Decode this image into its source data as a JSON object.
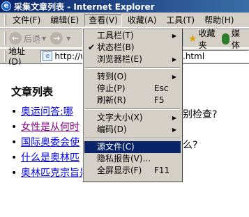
{
  "window": {
    "title": "采集文章列表 - Internet Explorer"
  },
  "menubar": {
    "items": [
      {
        "label": "文件(F)"
      },
      {
        "label": "编辑(E)"
      },
      {
        "label": "查看(V)"
      },
      {
        "label": "收藏(A)"
      },
      {
        "label": "工具(T)"
      },
      {
        "label": "帮助(H)"
      }
    ]
  },
  "toolbar": {
    "back_label": "后退",
    "favorites_label": "收藏夹",
    "media_label": "媒体"
  },
  "address": {
    "label": "地址(D)",
    "url_left": "http://w",
    "url_right": "c.html"
  },
  "page": {
    "heading": "文章列表",
    "bullet": "•",
    "articles": [
      {
        "left": "奥运问答:哪",
        "right": "别检查?"
      },
      {
        "left": "女性是从何时",
        "right": ""
      },
      {
        "left": "国际奥委会使",
        "right": "么?"
      },
      {
        "left": "什么是奥林匹",
        "right": ""
      },
      {
        "left": "奥林匹克宗旨是什么?",
        "right": ""
      }
    ]
  },
  "view_menu": {
    "items": [
      {
        "label": "工具栏(T)",
        "shortcut": "",
        "submenu": true
      },
      {
        "label": "状态栏(B)",
        "shortcut": "",
        "checked": true
      },
      {
        "label": "浏览器栏(E)",
        "shortcut": "",
        "submenu": true
      },
      {
        "label": "转到(O)",
        "shortcut": "",
        "submenu": true
      },
      {
        "label": "停止(P)",
        "shortcut": "Esc"
      },
      {
        "label": "刷新(R)",
        "shortcut": "F5"
      },
      {
        "label": "文字大小(X)",
        "shortcut": "",
        "submenu": true
      },
      {
        "label": "编码(D)",
        "shortcut": "",
        "submenu": true
      },
      {
        "label": "源文件(C)",
        "shortcut": ""
      },
      {
        "label": "隐私报告(V)...",
        "shortcut": ""
      },
      {
        "label": "全屏显示(F)",
        "shortcut": "F11"
      }
    ],
    "check_mark": "✔",
    "submenu_arrow": "▶"
  }
}
